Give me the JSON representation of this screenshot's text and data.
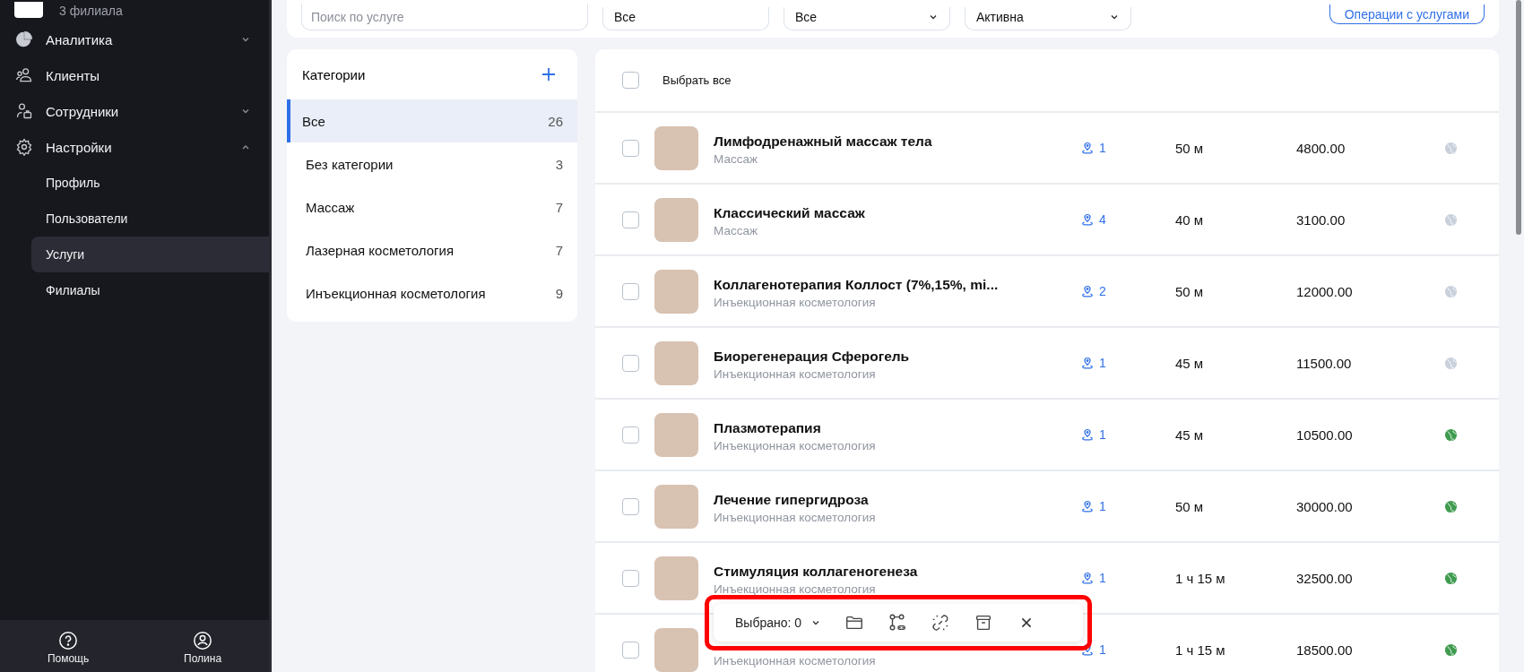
{
  "brand": {
    "subtitle": "3 филиала"
  },
  "nav": [
    {
      "label": "Аналитика",
      "expanded": false,
      "selected": false
    },
    {
      "label": "Клиенты",
      "selected": false
    },
    {
      "label": "Сотрудники",
      "expanded": false,
      "selected": false
    },
    {
      "label": "Настройки",
      "expanded": true,
      "selected": false,
      "children": [
        {
          "label": "Профиль",
          "selected": false
        },
        {
          "label": "Пользователи",
          "selected": false
        },
        {
          "label": "Услуги",
          "selected": true
        },
        {
          "label": "Филиалы",
          "selected": false
        }
      ]
    }
  ],
  "footer": [
    {
      "label": "Помощь"
    },
    {
      "label": "Полина"
    }
  ],
  "filters": {
    "search": {
      "placeholder": "Поиск по услуге"
    },
    "selects": [
      {
        "value": "Все"
      },
      {
        "value": "Все"
      },
      {
        "value": "Активна"
      }
    ],
    "action": "Операции с услугами"
  },
  "categories": {
    "title": "Категории",
    "items": [
      {
        "label": "Все",
        "count": "26",
        "selected": true
      },
      {
        "label": "Без категории",
        "count": "3",
        "selected": false
      },
      {
        "label": "Массаж",
        "count": "7",
        "selected": false
      },
      {
        "label": "Лазерная косметология",
        "count": "7",
        "selected": false
      },
      {
        "label": "Инъекционная косметология",
        "count": "9",
        "selected": false
      }
    ]
  },
  "list": {
    "select_all": {
      "label": "Выбрать все",
      "checked": false
    },
    "rows": [
      {
        "name": "Лимфодренажный массаж тела",
        "category": "Массаж",
        "branches": "1",
        "duration": "50 м",
        "price": "4800.00",
        "online": false,
        "checked": false
      },
      {
        "name": "Классический массаж",
        "category": "Массаж",
        "branches": "4",
        "duration": "40 м",
        "price": "3100.00",
        "online": false,
        "checked": false
      },
      {
        "name": "Коллагенотерапия Коллост (7%,15%, mi...",
        "category": "Инъекционная косметология",
        "branches": "2",
        "duration": "50 м",
        "price": "12000.00",
        "online": false,
        "checked": false
      },
      {
        "name": "Биорегенерация Сферогель",
        "category": "Инъекционная косметология",
        "branches": "1",
        "duration": "45 м",
        "price": "11500.00",
        "online": false,
        "checked": false
      },
      {
        "name": "Плазмотерапия",
        "category": "Инъекционная косметология",
        "branches": "1",
        "duration": "45 м",
        "price": "10500.00",
        "online": true,
        "checked": false
      },
      {
        "name": "Лечение гипергидроза",
        "category": "Инъекционная косметология",
        "branches": "1",
        "duration": "50 м",
        "price": "30000.00",
        "online": true,
        "checked": false
      },
      {
        "name": "Стимуляция коллагеногенеза",
        "category": "Инъекционная косметология",
        "branches": "1",
        "duration": "1 ч 15 м",
        "price": "32500.00",
        "online": true,
        "checked": false
      },
      {
        "category": "Инъекционная косметология",
        "branches": "1",
        "duration": "1 ч 15 м",
        "price": "18500.00",
        "online": true,
        "checked": false
      }
    ]
  },
  "toolbar": {
    "selected": "Выбрано: 0",
    "highlighted": true
  }
}
